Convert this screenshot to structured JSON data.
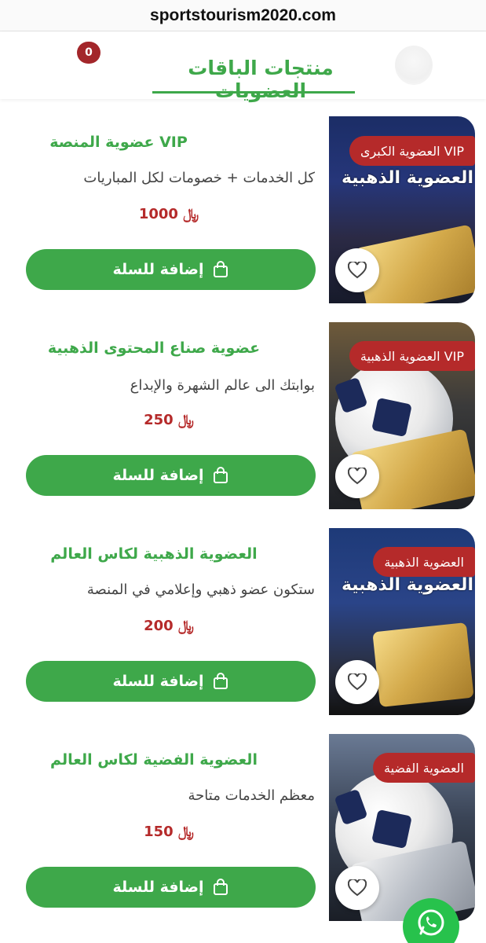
{
  "browser": {
    "url": "sportstourism2020.com"
  },
  "header": {
    "cart_count": "0",
    "title": "منتجات الباقات العضويات"
  },
  "colors": {
    "accent_green": "#3ea84a",
    "price_red": "#b52a2a",
    "badge_red": "#a3262a",
    "whatsapp_green": "#27c24c"
  },
  "icons": [
    "bag-icon",
    "heart-icon",
    "whatsapp-icon"
  ],
  "products": [
    {
      "name": "عضوية المنصة VIP",
      "description": "كل الخدمات + خصومات لكل المباريات",
      "price": "1000",
      "currency": "﷼",
      "image_badge": "العضوية الكبرى VIP",
      "image_heading": "العضوية الذهبية",
      "add_label": "إضافة للسلة"
    },
    {
      "name": "عضوية صناع المحتوى الذهبية",
      "description": "بوابتك الى عالم الشهرة والإبداع",
      "price": "250",
      "currency": "﷼",
      "image_badge": "العضوية الذهبية VIP",
      "add_label": "إضافة للسلة"
    },
    {
      "name": "العضوية الذهبية لكاس العالم",
      "description": "ستكون عضو ذهبي وإعلامي في المنصة",
      "price": "200",
      "currency": "﷼",
      "image_badge": "العضوية الذهبية",
      "image_heading": "العضوية الذهبية",
      "add_label": "إضافة للسلة"
    },
    {
      "name": "العضوية الفضية لكاس العالم",
      "description": "معظم الخدمات متاحة",
      "price": "150",
      "currency": "﷼",
      "image_badge": "العضوية الفضية",
      "add_label": "إضافة للسلة"
    }
  ]
}
